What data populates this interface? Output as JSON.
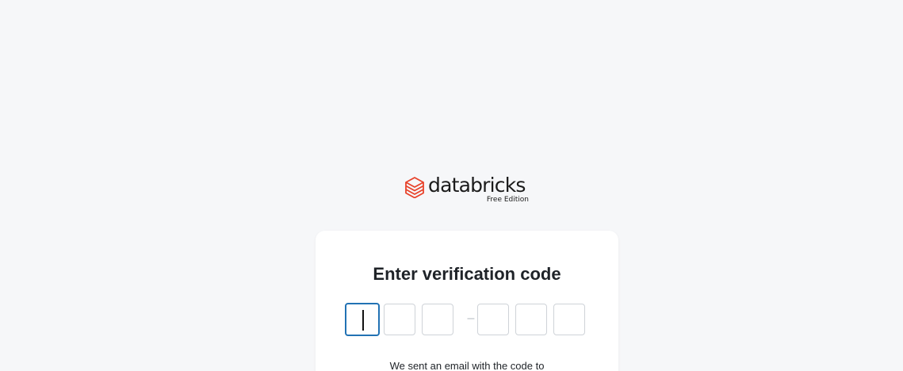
{
  "brand": {
    "name": "databricks",
    "edition": "Free Edition",
    "accent_color": "#e8432b",
    "logo_icon": "databricks-stack-icon"
  },
  "verification": {
    "title": "Enter verification code",
    "separator": "–",
    "digits": [
      "",
      "",
      "",
      "",
      "",
      ""
    ],
    "active_digit_index": 0,
    "focus_color": "#2272b4",
    "hint": "We sent an email with the code to"
  }
}
